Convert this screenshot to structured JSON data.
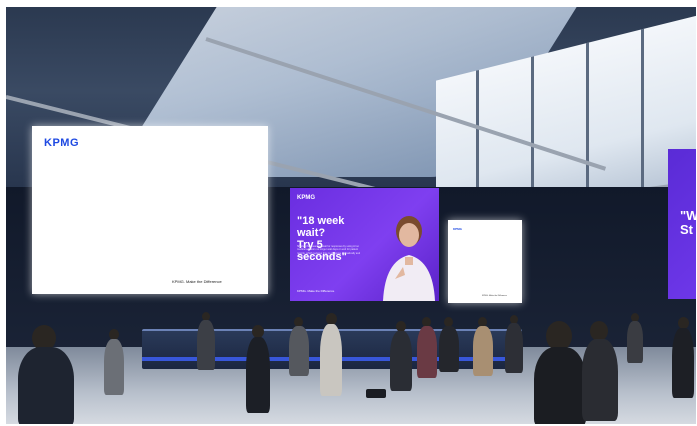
{
  "scene": {
    "description_free": true,
    "colors": {
      "kpmg_blue": "#1e49e2",
      "campaign_purple": "#6a2ee0"
    }
  },
  "screens": {
    "left": {
      "logo": "KPMG",
      "tagline": "KPMG. Make the Difference"
    },
    "center": {
      "logo": "KPMG",
      "headline_line1": "\"18 week wait?",
      "headline_line2": "Try 5 seconds\"",
      "body": "Shorten the meantime wait for responses by using AI so medical advisors no longer wait days on end for patient reports, which reduces time to diagnose dramatically and saves lives each and every day.",
      "tagline": "KPMG. Make the Difference"
    },
    "right": {
      "logo": "KPMG",
      "tagline": "KPMG. Make the Difference"
    },
    "far_right": {
      "headline": "\"W\nSt"
    }
  }
}
